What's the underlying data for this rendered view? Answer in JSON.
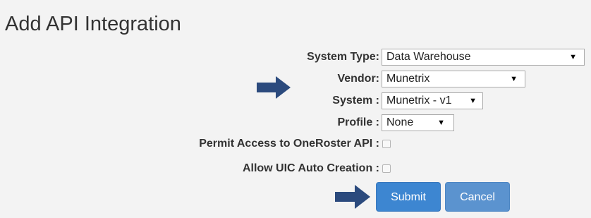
{
  "page": {
    "title": "Add API Integration"
  },
  "form": {
    "system_type": {
      "label": "System Type:",
      "value": "Data Warehouse"
    },
    "vendor": {
      "label": "Vendor:",
      "value": "Munetrix"
    },
    "system": {
      "label": "System :",
      "value": "Munetrix - v1"
    },
    "profile": {
      "label": "Profile :",
      "value": "None"
    },
    "permit_oneroster": {
      "label": "Permit Access to OneRoster API :",
      "checked": false
    },
    "allow_uic": {
      "label": "Allow UIC Auto Creation :",
      "checked": false
    }
  },
  "buttons": {
    "submit": "Submit",
    "cancel": "Cancel"
  },
  "colors": {
    "arrow": "#2b4a7d",
    "primary": "#3d86d1"
  },
  "icons": {
    "dropdown": "caret-down-icon",
    "annotation": "arrow-right-icon"
  }
}
